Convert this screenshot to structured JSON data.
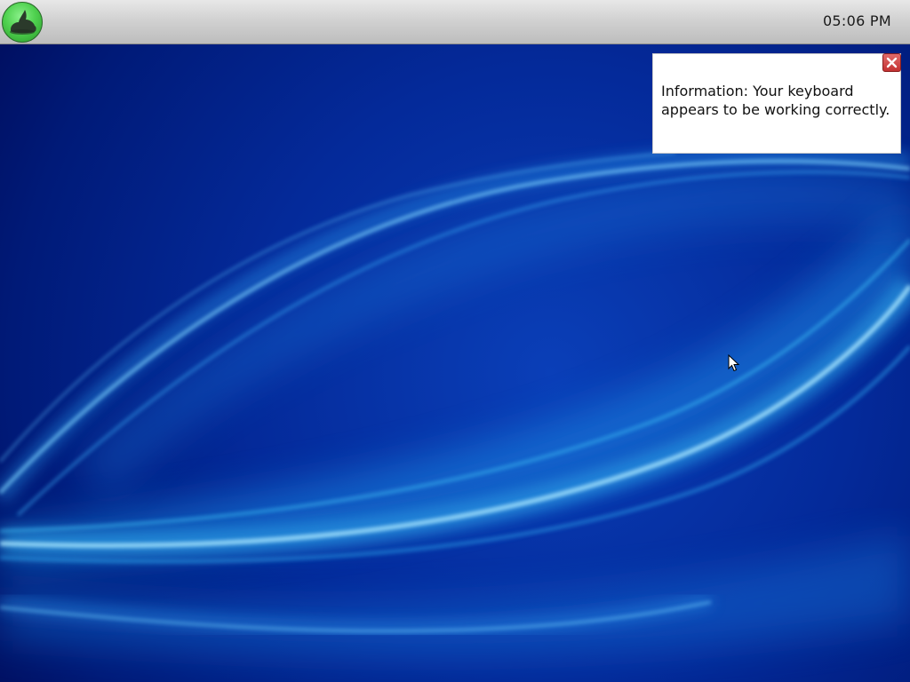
{
  "taskbar": {
    "clock": "05:06 PM",
    "start_icon": "green-globe-icon"
  },
  "notification": {
    "text": "Information: Your keyboard appears to be working correctly.",
    "close_icon": "close-icon"
  },
  "colors": {
    "desktop_dark": "#000c5a",
    "desktop_light": "#2ab4f0",
    "taskbar": "#d2d2d2",
    "start_button": "#4fd14f",
    "close_button": "#c43131"
  }
}
